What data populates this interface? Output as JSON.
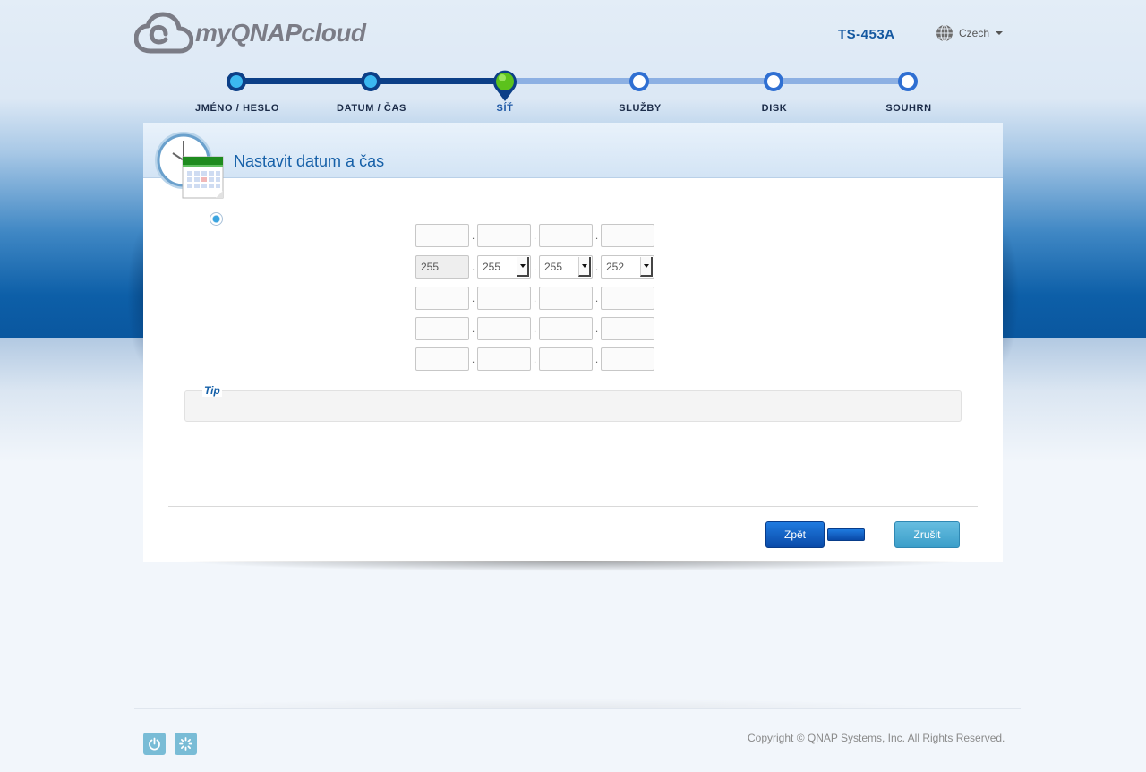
{
  "header": {
    "logo_text": "myQNAPcloud",
    "model": "TS-453A",
    "language": "Czech"
  },
  "steps": [
    {
      "label": "JMÉNO / HESLO",
      "state": "done"
    },
    {
      "label": "DATUM / ČAS",
      "state": "done"
    },
    {
      "label": "SÍŤ",
      "state": "current"
    },
    {
      "label": "SLUŽBY",
      "state": "todo"
    },
    {
      "label": "DISK",
      "state": "todo"
    },
    {
      "label": "SOUHRN",
      "state": "todo"
    }
  ],
  "panel": {
    "title": "Nastavit datum a čas",
    "icon": "clock-calendar-icon"
  },
  "ip_rows": [
    {
      "fields": [
        "",
        "",
        "",
        ""
      ]
    },
    {
      "fields": [
        "255",
        "255",
        "255",
        "252"
      ]
    },
    {
      "fields": [
        "",
        "",
        "",
        ""
      ]
    },
    {
      "fields": [
        "",
        "",
        "",
        ""
      ]
    },
    {
      "fields": [
        "",
        "",
        "",
        ""
      ]
    }
  ],
  "tip": {
    "title": "Tip"
  },
  "buttons": {
    "back": "Zpět",
    "next": "",
    "cancel": "Zrušit"
  },
  "footer": {
    "copyright": "Copyright © QNAP Systems, Inc. All Rights Reserved.",
    "icons": [
      "power-icon",
      "spinner-icon"
    ]
  },
  "colors": {
    "brand_blue": "#1660a8",
    "step_done": "#0c3f87",
    "step_todo": "#8db0e3",
    "current_pin": "#5cc21c"
  }
}
